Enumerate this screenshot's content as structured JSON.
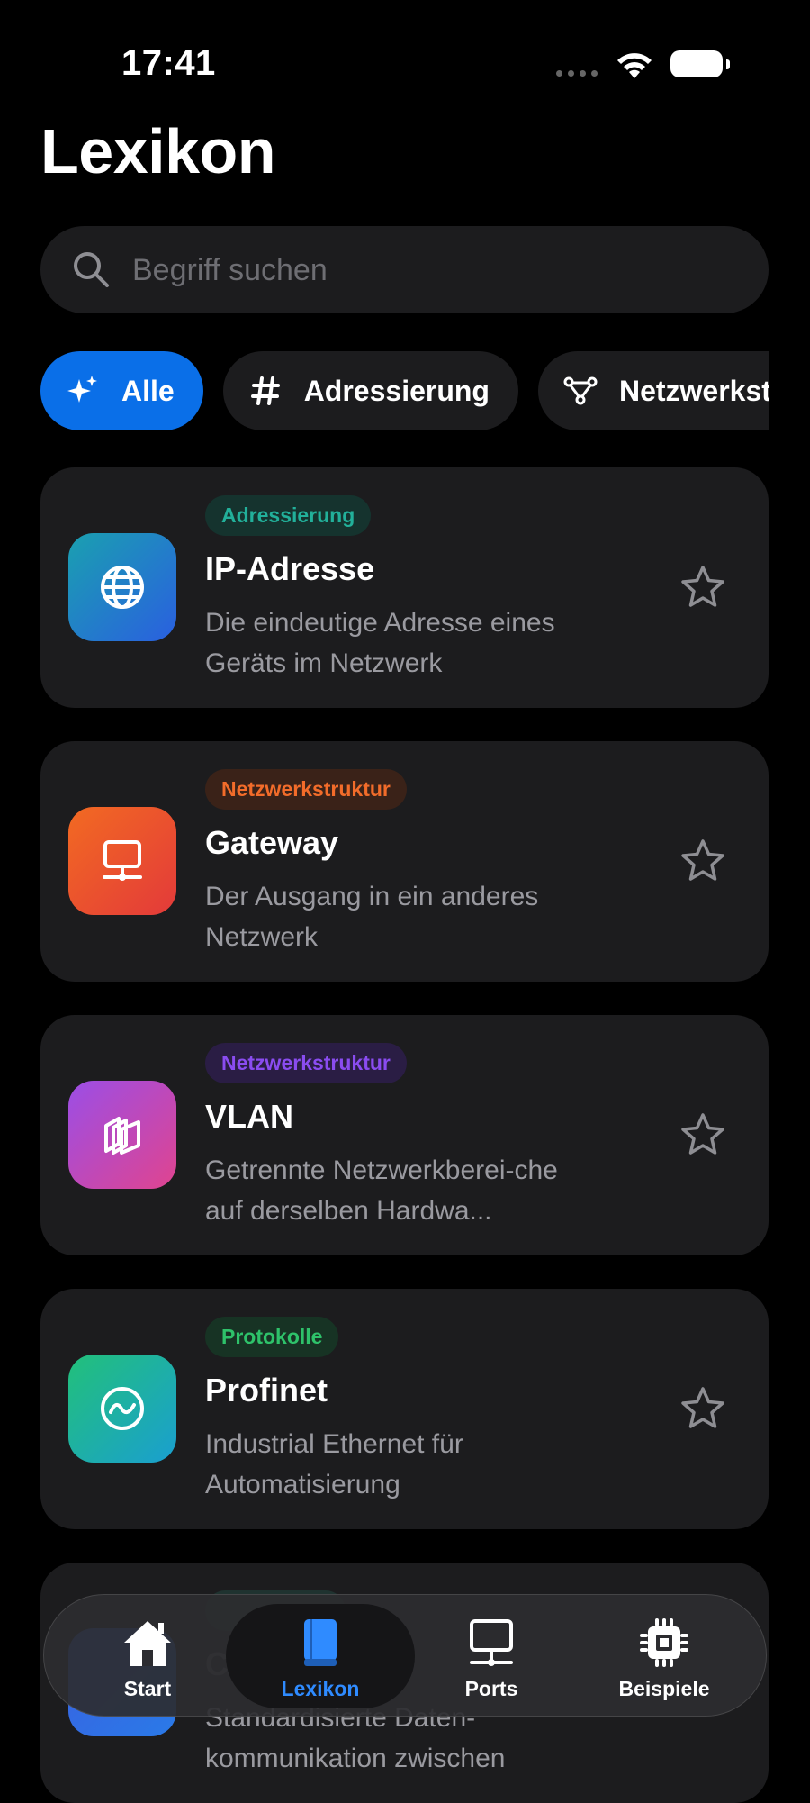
{
  "status_bar": {
    "time": "17:41"
  },
  "header": {
    "title": "Lexikon"
  },
  "search": {
    "placeholder": "Begriff suchen"
  },
  "chips": [
    {
      "label": "Alle",
      "icon": "sparkles-icon",
      "active": true
    },
    {
      "label": "Adressierung",
      "icon": "hashtag-icon",
      "active": false
    },
    {
      "label": "Netzwerkstruktur",
      "icon": "network-nodes-icon",
      "active": false
    }
  ],
  "entries": [
    {
      "category": "Adressierung",
      "title": "IP-Adresse",
      "description": "Die eindeutige Adresse eines Geräts im Netzwerk",
      "icon": "globe-icon",
      "badge_color": "#22b09a",
      "badge_bg": "#15332e",
      "gradient": [
        "#1aa0b0",
        "#2a5fe0"
      ]
    },
    {
      "category": "Netzwerkstruktur",
      "title": "Gateway",
      "description": "Der Ausgang in ein anderes Netzwerk",
      "icon": "network-computer-icon",
      "badge_color": "#f26c2a",
      "badge_bg": "#3a2218",
      "gradient": [
        "#f26a22",
        "#e33a3a"
      ]
    },
    {
      "category": "Netzwerkstruktur",
      "title": "VLAN",
      "description": "Getrennte Netzwerkberei-che auf derselben Hardwa...",
      "icon": "stacked-squares-icon",
      "badge_color": "#8a4cf0",
      "badge_bg": "#2a1d44",
      "gradient": [
        "#9b4ee6",
        "#e0448f"
      ]
    },
    {
      "category": "Protokolle",
      "title": "Profinet",
      "description": "Industrial Ethernet für Automatisierung",
      "icon": "waveform-circle-icon",
      "badge_color": "#2ec26a",
      "badge_bg": "#173324",
      "gradient": [
        "#22c07a",
        "#1a9fd0"
      ]
    }
  ],
  "partial_entry": {
    "title_partial": "C",
    "description": "Standardisierte Daten-kommunikation zwischen"
  },
  "tabbar": {
    "tabs": [
      {
        "label": "Start",
        "icon": "house-icon",
        "active": false
      },
      {
        "label": "Lexikon",
        "icon": "book-icon",
        "active": true
      },
      {
        "label": "Ports",
        "icon": "desktop-icon",
        "active": false
      },
      {
        "label": "Beispiele",
        "icon": "cpu-chip-icon",
        "active": false
      }
    ]
  },
  "colors": {
    "accent": "#0a6fe8",
    "tab_active": "#2f8bff",
    "card_bg": "#1c1c1e",
    "background": "#000000"
  }
}
